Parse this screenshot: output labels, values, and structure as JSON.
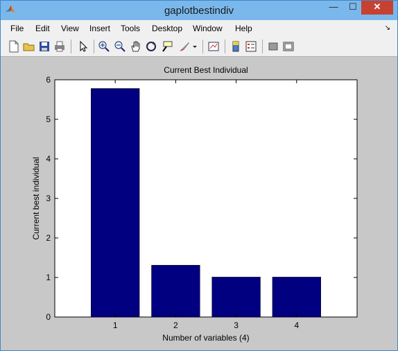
{
  "window": {
    "title": "gaplotbestindiv",
    "controls": {
      "minimize": "—",
      "maximize": "☐",
      "close": "✕"
    }
  },
  "menu": {
    "items": [
      "File",
      "Edit",
      "View",
      "Insert",
      "Tools",
      "Desktop",
      "Window",
      "Help"
    ],
    "arrow": "↘"
  },
  "toolbar": {
    "icons": [
      "new-figure-icon",
      "open-file-icon",
      "save-icon",
      "print-icon",
      "pointer-icon",
      "zoom-in-icon",
      "zoom-out-icon",
      "pan-icon",
      "rotate-icon",
      "data-cursor-icon",
      "brush-icon",
      "link-plot-icon",
      "colorbar-icon",
      "legend-icon",
      "hide-plot-tools-icon",
      "show-plot-tools-icon"
    ]
  },
  "chart_data": {
    "type": "bar",
    "title": "Current Best Individual",
    "xlabel": "Number of variables (4)",
    "ylabel": "Current best individual",
    "categories": [
      "1",
      "2",
      "3",
      "4"
    ],
    "values": [
      5.78,
      1.31,
      1.01,
      1.01
    ],
    "ylim": [
      0,
      6
    ],
    "yticks": [
      "0",
      "1",
      "2",
      "3",
      "4",
      "5",
      "6"
    ],
    "xlim": [
      0,
      5
    ],
    "bar_color": "#000080",
    "grid": false
  }
}
